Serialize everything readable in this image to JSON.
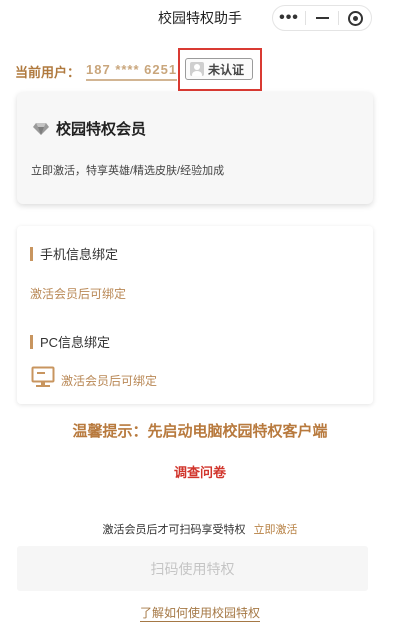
{
  "nav": {
    "title": "校园特权助手",
    "capsule_icons": [
      "more-icon",
      "minimize-icon",
      "close-target-icon"
    ]
  },
  "user": {
    "label": "当前用户：",
    "phone": "187 **** 6251",
    "cert_status": "未认证"
  },
  "membership": {
    "title": "校园特权会员",
    "desc": "立即激活，特享英雄/精选皮肤/经验加成",
    "icon": "diamond-icon"
  },
  "binding": {
    "phone_title": "手机信息绑定",
    "phone_note": "激活会员后可绑定",
    "pc_title": "PC信息绑定",
    "pc_note": "激活会员后可绑定",
    "pc_icon": "monitor-icon"
  },
  "tip": "温馨提示：先启动电脑校园特权客户端",
  "survey": "调查问卷",
  "activate": {
    "text": "激活会员后才可扫码享受特权",
    "link": "立即激活"
  },
  "scan_button": "扫码使用特权",
  "learn_link": "了解如何使用校园特权",
  "colors": {
    "accent": "#b87a3e",
    "highlight_box": "#d93a32",
    "survey": "#d1352c"
  }
}
